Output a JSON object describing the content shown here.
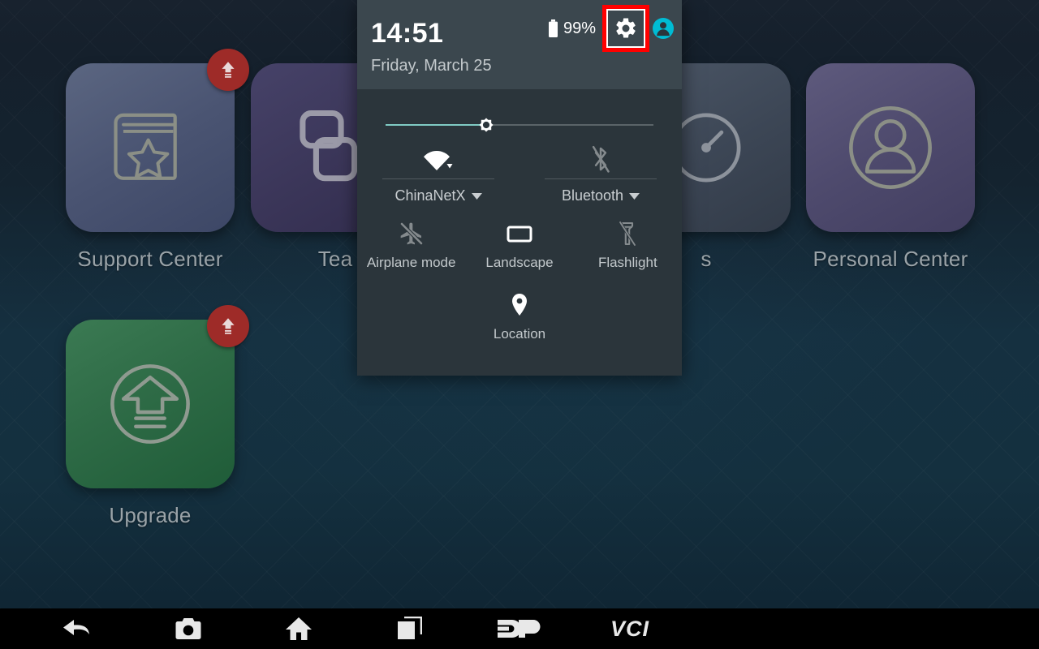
{
  "wallpaper": {
    "bg_top": "#18222e",
    "bg_mid": "#153040",
    "bg_bottom": "#102634"
  },
  "desktop": {
    "apps": [
      {
        "name": "Support Center",
        "label": "Support Center",
        "icon": "book-star-icon",
        "tile_class": "tile-support",
        "badge": true
      },
      {
        "name": "Team",
        "label": "Tea",
        "icon": "chat-bubbles-icon",
        "tile_class": "tile-team",
        "badge": false
      },
      {
        "name": "Diagnostics",
        "label": "s",
        "icon": "gauge-icon",
        "tile_class": "tile-diag",
        "badge": false
      },
      {
        "name": "Personal Center",
        "label": "Personal Center",
        "icon": "person-circle-icon",
        "tile_class": "tile-personal",
        "badge": false
      },
      {
        "name": "Upgrade",
        "label": "Upgrade",
        "icon": "upload-circle-icon",
        "tile_class": "tile-upgrade",
        "badge": true
      }
    ]
  },
  "panel": {
    "time": "14:51",
    "date": "Friday, March 25",
    "battery_percent": "99%",
    "battery_icon": "battery-full-icon",
    "settings_icon": "gear-icon",
    "avatar_icon": "user-avatar-icon",
    "avatar_color": "#00bcd4",
    "highlight_color": "#ff0000",
    "brightness": {
      "icon": "brightness-sun-icon",
      "value": 37,
      "fill_color": "#80cbc4",
      "track_color": "#5b6468"
    },
    "toggles_large": [
      {
        "name": "wifi",
        "label": "ChinaNetX",
        "icon": "wifi-icon",
        "state": "on",
        "has_caret": true
      },
      {
        "name": "bluetooth",
        "label": "Bluetooth",
        "icon": "bluetooth-off-icon",
        "state": "off",
        "has_caret": true
      }
    ],
    "toggles_small": [
      {
        "name": "airplane-mode",
        "label": "Airplane mode",
        "icon": "airplane-off-icon",
        "state": "off"
      },
      {
        "name": "landscape",
        "label": "Landscape",
        "icon": "landscape-icon",
        "state": "on"
      },
      {
        "name": "flashlight",
        "label": "Flashlight",
        "icon": "flashlight-off-icon",
        "state": "off"
      },
      {
        "name": "location",
        "label": "Location",
        "icon": "location-pin-icon",
        "state": "on"
      }
    ]
  },
  "navbar": {
    "buttons": [
      {
        "name": "back",
        "icon": "back-arrow-icon"
      },
      {
        "name": "screenshot",
        "icon": "camera-icon"
      },
      {
        "name": "home",
        "icon": "home-icon"
      },
      {
        "name": "recents",
        "icon": "recent-apps-icon"
      }
    ],
    "logos": [
      {
        "name": "dp-logo",
        "text": "DP"
      },
      {
        "name": "vci-logo",
        "text": "VCI"
      }
    ]
  }
}
